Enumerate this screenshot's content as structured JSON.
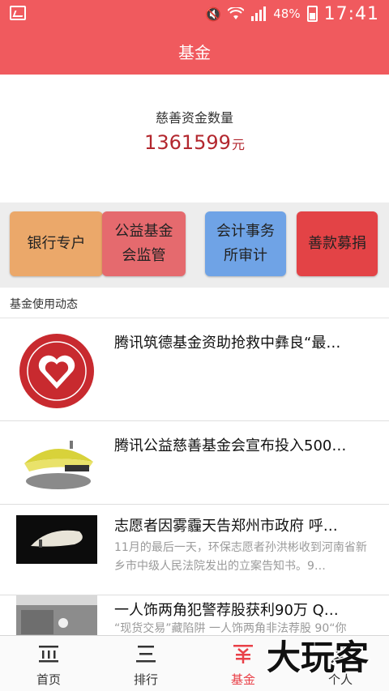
{
  "status_bar": {
    "battery": "48%",
    "time": "17:41",
    "icons": [
      "image-icon",
      "mute-icon",
      "wifi-icon",
      "signal-icon",
      "battery-icon"
    ]
  },
  "header": {
    "title": "基金"
  },
  "summary": {
    "label": "慈善资金数量",
    "amount": "1361599",
    "unit": "元"
  },
  "actions": [
    {
      "label": "银行专户",
      "color": "#eba86a"
    },
    {
      "label": "公益基金会监管",
      "color": "#e56a6e"
    },
    {
      "label": "会计事务所审计",
      "color": "#6fa3e6"
    },
    {
      "label": "善款募捐",
      "color": "#e34346"
    }
  ],
  "section": {
    "label": "基金使用动态"
  },
  "news": [
    {
      "title": "腾讯筑德基金资助抢救中彝良“最…",
      "desc": ""
    },
    {
      "title": "腾讯公益慈善基金会宣布投入500…",
      "desc": ""
    },
    {
      "title": "志愿者因雾霾天告郑州市政府 呼…",
      "desc": "11月的最后一天，环保志愿者孙洪彬收到河南省新乡市中级人民法院发出的立案告知书。9…"
    },
    {
      "title": "一人饰两角犯警荐股获利90万 Q…",
      "desc": "“现货交易”藏陷阱 一人饰两角非法荐股 90“你"
    }
  ],
  "tabs": [
    {
      "label": "首页",
      "icon": "home-icon"
    },
    {
      "label": "排行",
      "icon": "ranking-icon"
    },
    {
      "label": "基金",
      "icon": "fund-icon",
      "active": true
    },
    {
      "label": "个人",
      "icon": "person-icon"
    }
  ],
  "watermark": {
    "text": "大玩客"
  },
  "colors": {
    "primary": "#f05a5e",
    "amount": "#b3272e",
    "tab_active": "#e94048"
  }
}
